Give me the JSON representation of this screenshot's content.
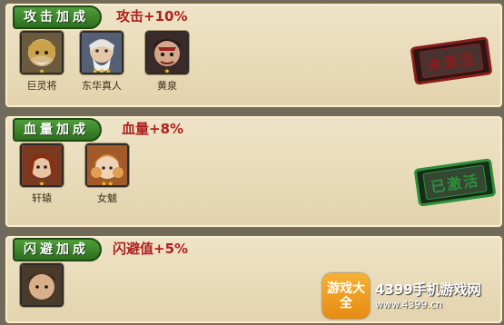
{
  "panels": [
    {
      "title": "攻击加成",
      "bonus": "攻击+10%",
      "status": "未激活",
      "heroes": [
        {
          "name": "巨灵将",
          "stars": "★"
        },
        {
          "name": "东华真人",
          "stars": "★★★"
        },
        {
          "name": "黄泉",
          "stars": "★"
        }
      ]
    },
    {
      "title": "血量加成",
      "bonus": "血量+8%",
      "status": "已激活",
      "heroes": [
        {
          "name": "轩辕",
          "stars": "★"
        },
        {
          "name": "女魃",
          "stars": "★★"
        }
      ]
    },
    {
      "title": "闪避加成",
      "bonus": "闪避值+5%",
      "heroes": [
        {
          "name": "",
          "stars": ""
        }
      ]
    }
  ],
  "watermark": {
    "logo": "游戏大全",
    "title": "4399手机游戏网",
    "url": "www.4399.cn"
  },
  "colors": {
    "tag_green": "#3a8a2a",
    "bonus_red": "#b01f1f",
    "inactive_red": "#8c1c1c",
    "active_green": "#2f8f3a"
  }
}
